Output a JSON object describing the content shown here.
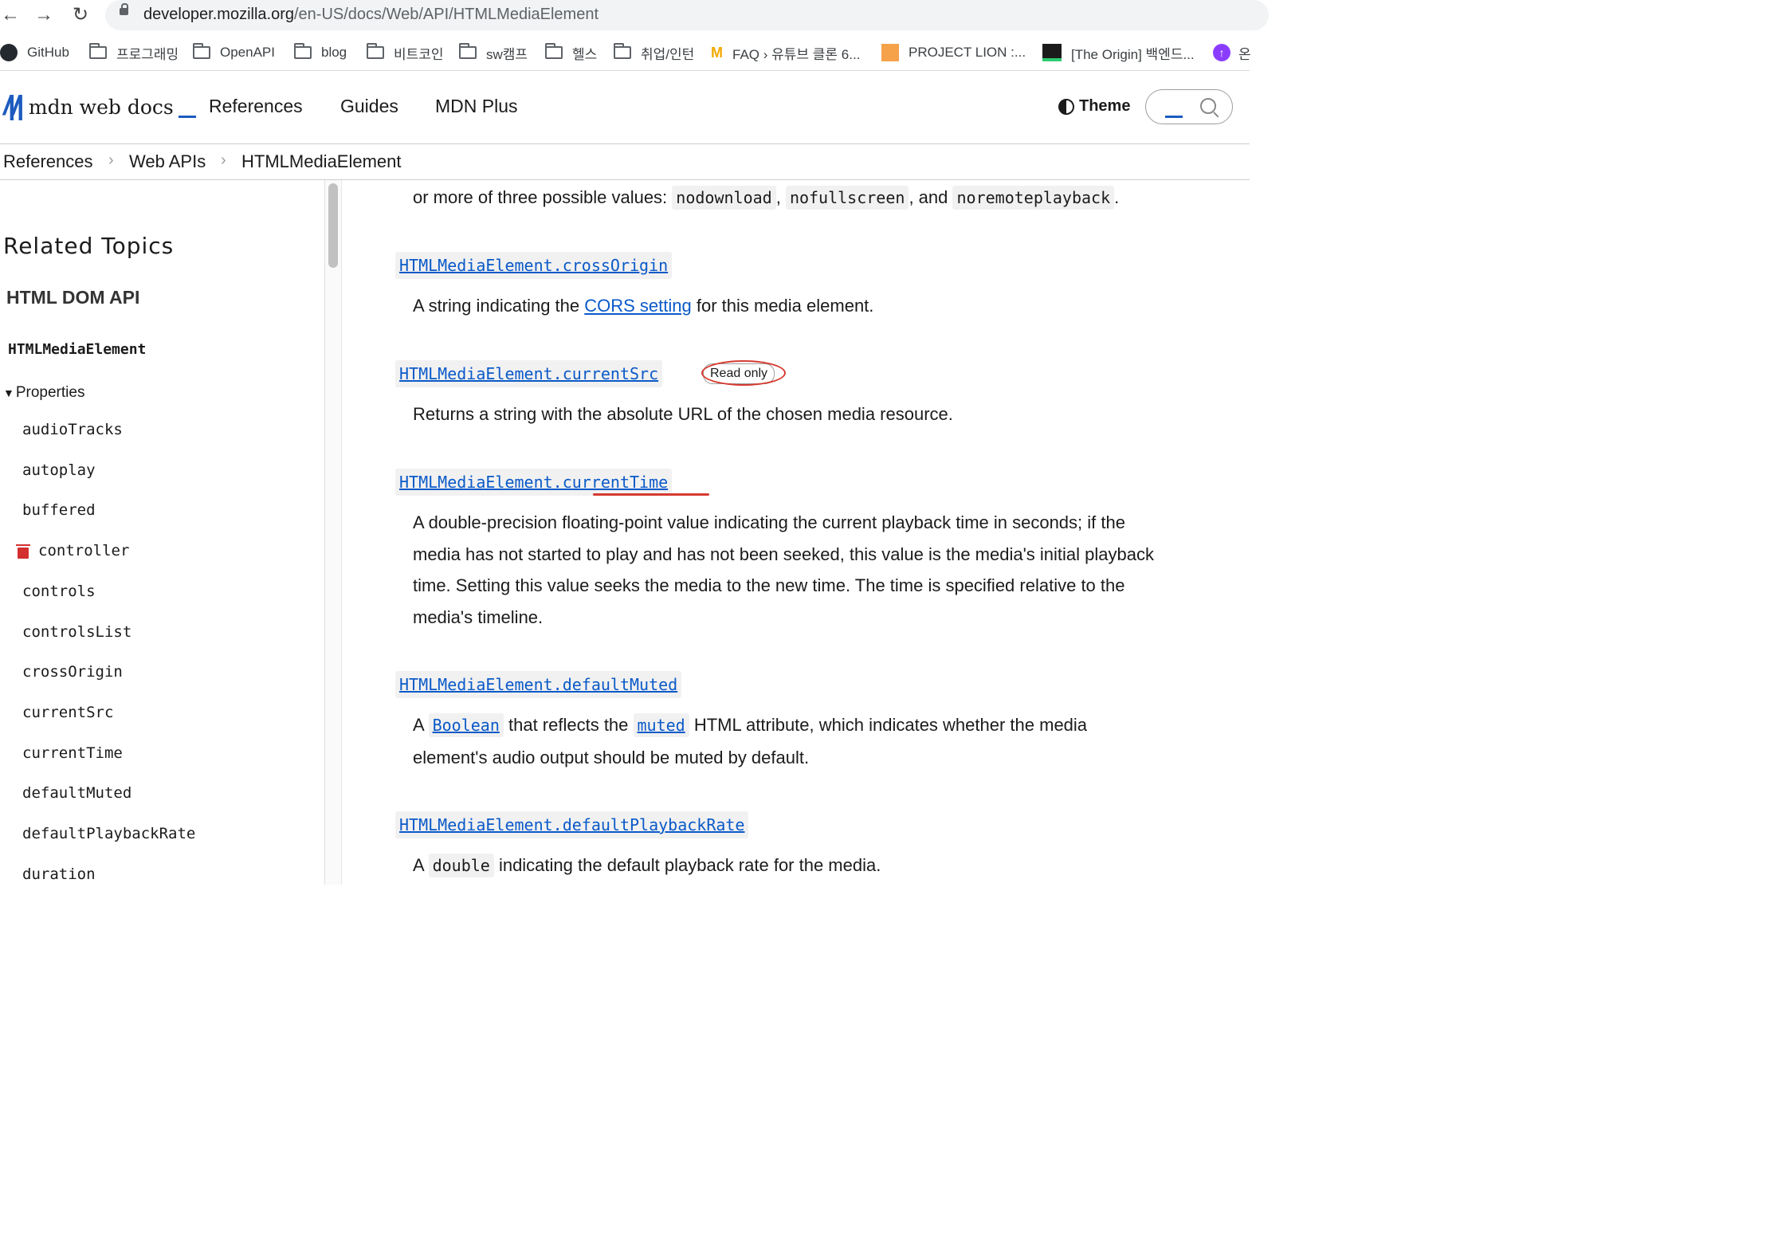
{
  "browser": {
    "url_host": "developer.mozilla.org",
    "url_path": "/en-US/docs/Web/API/HTMLMediaElement",
    "bookmarks": [
      {
        "label": "GitHub",
        "icon": "github-icon"
      },
      {
        "label": "프로그래밍",
        "icon": "folder-icon"
      },
      {
        "label": "OpenAPI",
        "icon": "folder-icon"
      },
      {
        "label": "blog",
        "icon": "folder-icon"
      },
      {
        "label": "비트코인",
        "icon": "folder-icon"
      },
      {
        "label": "sw캠프",
        "icon": "folder-icon"
      },
      {
        "label": "헬스",
        "icon": "folder-icon"
      },
      {
        "label": "취업/인턴",
        "icon": "folder-icon"
      },
      {
        "label": "FAQ › 유튜브 클론 6...",
        "icon": "mcdonalds-icon"
      },
      {
        "label": "PROJECT LION :...",
        "icon": "lion-icon"
      },
      {
        "label": "[The Origin] 백엔드...",
        "icon": "origin-icon"
      },
      {
        "label": "온",
        "icon": "purple-icon"
      }
    ]
  },
  "header": {
    "logo_text": "mdn web docs",
    "nav": [
      "References",
      "Guides",
      "MDN Plus"
    ],
    "theme_label": "Theme",
    "accent": "#1d5bbf"
  },
  "breadcrumb": [
    "References",
    "Web APIs",
    "HTMLMediaElement"
  ],
  "sidebar": {
    "heading": "Related Topics",
    "api_title": "HTML DOM API",
    "interface": "HTMLMediaElement",
    "group_label": "Properties",
    "items": [
      "audioTracks",
      "autoplay",
      "buffered",
      "controller",
      "controls",
      "controlsList",
      "crossOrigin",
      "currentSrc",
      "currentTime",
      "defaultMuted",
      "defaultPlaybackRate",
      "duration"
    ],
    "deprecated_item": "controller"
  },
  "content": {
    "intro": {
      "text_before": "or more of three possible values: ",
      "codes": [
        "nodownload",
        "nofullscreen",
        "noremoteplayback"
      ],
      "sep1": ", ",
      "sep2": ", and ",
      "end": "."
    },
    "entries": [
      {
        "term": "HTMLMediaElement.crossOrigin",
        "desc_before": "A string indicating the ",
        "desc_link": "CORS setting",
        "desc_after": " for this media element."
      },
      {
        "term": "HTMLMediaElement.currentSrc",
        "badge": "Read only",
        "desc": "Returns a string with the absolute URL of the chosen media resource."
      },
      {
        "term": "HTMLMediaElement.currentTime",
        "desc_lines": [
          "A double-precision floating-point value indicating the current playback time in seconds; if the",
          "media has not started to play and has not been seeked, this value is the media's initial playback",
          "time. Setting this value seeks the media to the new time. The time is specified relative to the",
          "media's timeline."
        ]
      },
      {
        "term": "HTMLMediaElement.defaultMuted",
        "desc_a": "A ",
        "desc_link1": "Boolean",
        "desc_b": " that reflects the ",
        "desc_link2": "muted",
        "desc_c": " HTML attribute, which indicates whether the media",
        "desc_line2": "element's audio output should be muted by default."
      },
      {
        "term": "HTMLMediaElement.defaultPlaybackRate",
        "desc_a": "A ",
        "desc_code": "double",
        "desc_b": " indicating the default playback rate for the media."
      }
    ],
    "annotation_color": "#d63a2f",
    "link_color": "#0a5ac8"
  }
}
